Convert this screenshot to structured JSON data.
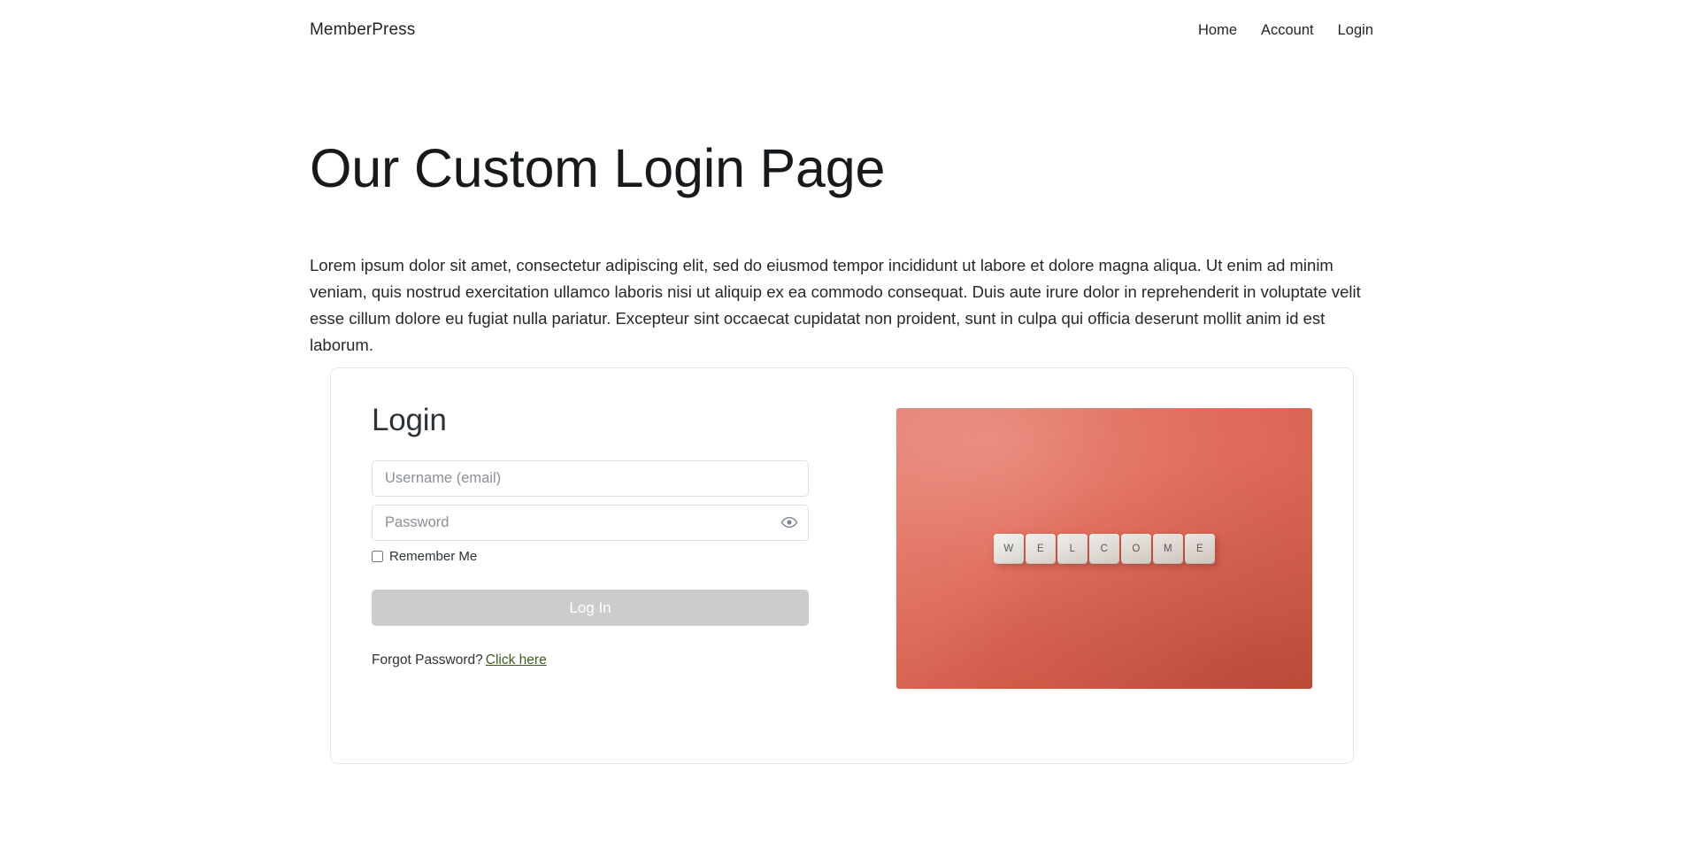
{
  "header": {
    "brand": "MemberPress",
    "nav": [
      {
        "label": "Home"
      },
      {
        "label": "Account"
      },
      {
        "label": "Login"
      }
    ]
  },
  "main": {
    "title": "Our Custom Login Page",
    "paragraph": "Lorem ipsum dolor sit amet, consectetur adipiscing elit, sed do eiusmod tempor incididunt ut labore et dolore magna aliqua. Ut enim ad minim veniam, quis nostrud exercitation ullamco laboris nisi ut aliquip ex ea commodo consequat. Duis aute irure dolor in reprehenderit in voluptate velit esse cillum dolore eu fugiat nulla pariatur. Excepteur sint occaecat cupidatat non proident, sunt in culpa qui officia deserunt mollit anim id est laborum."
  },
  "login_card": {
    "title": "Login",
    "username": {
      "placeholder": "Username (email)",
      "value": ""
    },
    "password": {
      "placeholder": "Password",
      "value": "",
      "toggle_icon": "eye-icon"
    },
    "remember": {
      "label": "Remember Me",
      "checked": false
    },
    "submit_label": "Log In",
    "forgot": {
      "text": "Forgot Password?",
      "link_label": "Click here"
    },
    "image": {
      "alt": "WELCOME spelled with keyboard keycaps on a coral background",
      "keycaps": [
        "W",
        "E",
        "L",
        "C",
        "O",
        "M",
        "E"
      ],
      "background_color": "#e2705f"
    }
  },
  "colors": {
    "text": "#2c3338",
    "muted": "#8b9096",
    "border": "#dcdfe2",
    "card_border": "#e6e7e9",
    "button_bg": "#cccccc",
    "link": "#3d5c20",
    "photo_coral": "#e2705f"
  }
}
